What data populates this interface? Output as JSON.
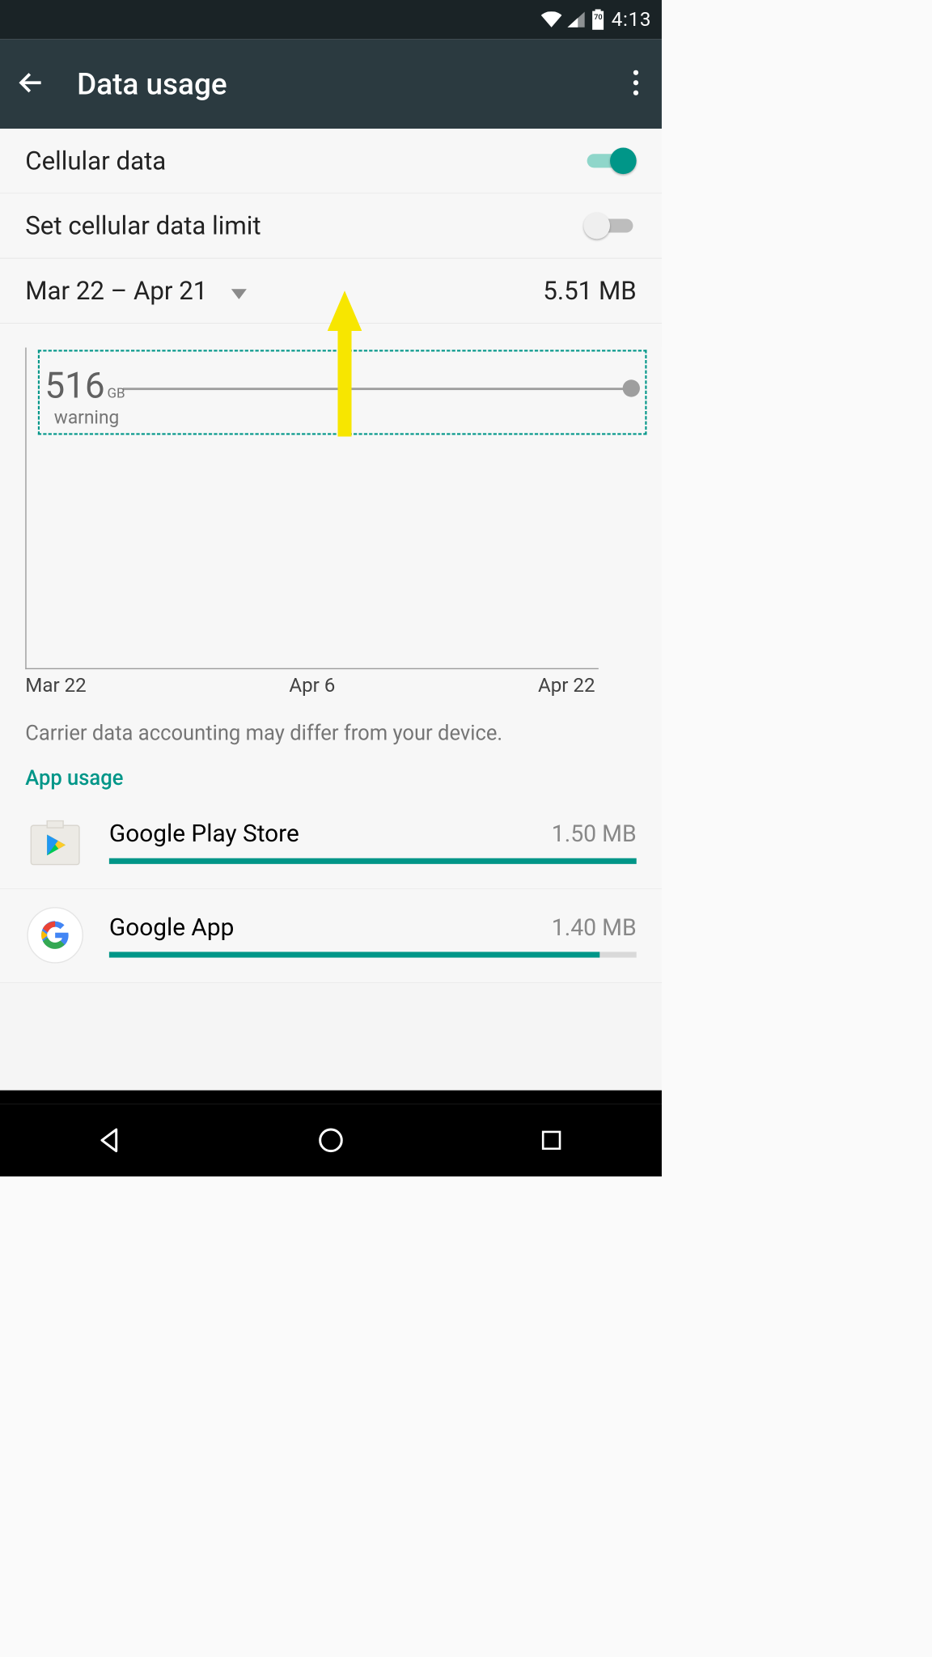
{
  "status": {
    "battery_pct": "70",
    "clock": "4:13"
  },
  "header": {
    "title": "Data usage"
  },
  "settings": {
    "cellular_data_label": "Cellular data",
    "set_limit_label": "Set cellular data limit"
  },
  "cycle": {
    "range_label": "Mar 22 – Apr 21",
    "total_used": "5.51 MB"
  },
  "chart_data": {
    "type": "line",
    "title": "",
    "xlabel": "",
    "ylabel": "",
    "x_ticks": [
      "Mar 22",
      "Apr 6",
      "Apr 22"
    ],
    "ylim_gb": [
      0,
      516
    ],
    "warning_threshold": {
      "value": 516,
      "unit": "GB",
      "label": "warning"
    },
    "x": [
      "Mar 22",
      "Apr 22"
    ],
    "usage_mb": [
      0,
      5.51
    ]
  },
  "disclaimer": "Carrier data accounting may differ from your device.",
  "app_usage": {
    "title": "App usage",
    "items": [
      {
        "name": "Google Play Store",
        "amount": "1.50 MB",
        "pct": 100
      },
      {
        "name": "Google App",
        "amount": "1.40 MB",
        "pct": 93
      }
    ]
  }
}
